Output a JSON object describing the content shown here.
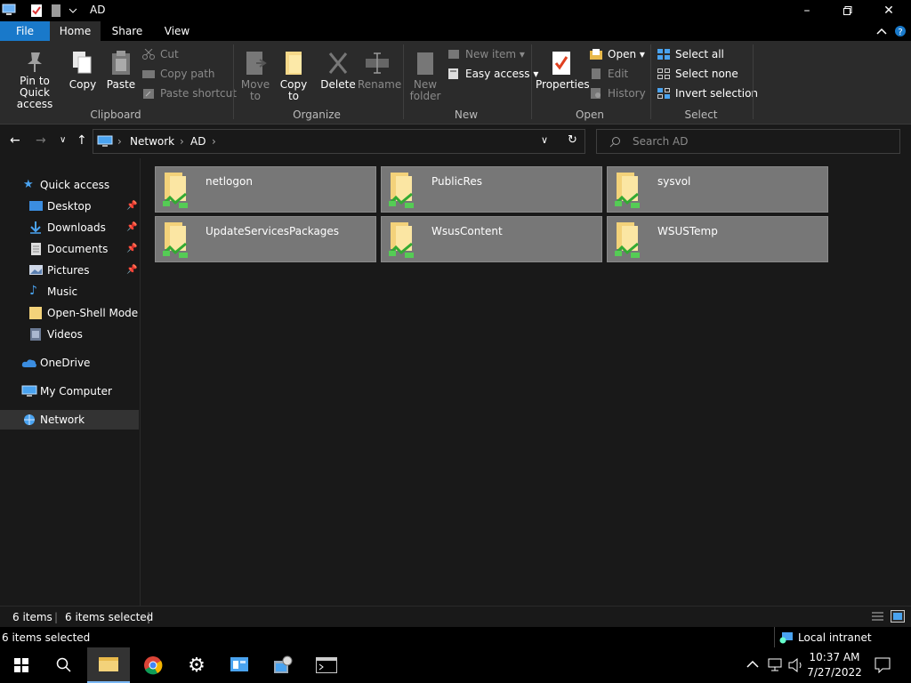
{
  "window": {
    "title": "AD",
    "minimize_icon": "minimize-icon",
    "maximize_icon": "maximize-icon",
    "close_icon": "close-icon"
  },
  "ribbon_tabs": [
    {
      "label": "File"
    },
    {
      "label": "Home"
    },
    {
      "label": "Share"
    },
    {
      "label": "View"
    }
  ],
  "clipboard": {
    "pin_line1": "Pin to Quick",
    "pin_line2": "access",
    "copy": "Copy",
    "paste": "Paste",
    "cut": "Cut",
    "copy_path": "Copy path",
    "paste_shortcut": "Paste shortcut",
    "group": "Clipboard"
  },
  "organize": {
    "move_line1": "Move",
    "move_line2": "to",
    "copy_line1": "Copy",
    "copy_line2": "to",
    "delete": "Delete",
    "rename": "Rename",
    "group": "Organize"
  },
  "new": {
    "new_folder_line1": "New",
    "new_folder_line2": "folder",
    "new_item": "New item",
    "easy_access": "Easy access",
    "group": "New"
  },
  "open": {
    "properties": "Properties",
    "open": "Open",
    "edit": "Edit",
    "history": "History",
    "group": "Open"
  },
  "select": {
    "select_all": "Select all",
    "select_none": "Select none",
    "invert_selection": "Invert selection",
    "group": "Select"
  },
  "address": {
    "crumbs": [
      "Network",
      "AD"
    ],
    "search_placeholder": "Search AD"
  },
  "sidebar": {
    "items": [
      {
        "label": "Quick access",
        "pinned": false
      },
      {
        "label": "Desktop",
        "pinned": true
      },
      {
        "label": "Downloads",
        "pinned": true
      },
      {
        "label": "Documents",
        "pinned": true
      },
      {
        "label": "Pictures",
        "pinned": true
      },
      {
        "label": "Music",
        "pinned": false
      },
      {
        "label": "Open-Shell Modern",
        "pinned": false
      },
      {
        "label": "Videos",
        "pinned": false
      },
      {
        "label": "OneDrive",
        "pinned": false
      },
      {
        "label": "My Computer",
        "pinned": false
      },
      {
        "label": "Network",
        "pinned": false
      }
    ],
    "pin_glyph": "📌"
  },
  "files": [
    {
      "name": "netlogon"
    },
    {
      "name": "PublicRes"
    },
    {
      "name": "sysvol"
    },
    {
      "name": "UpdateServicesPackages"
    },
    {
      "name": "WsusContent"
    },
    {
      "name": "WSUSTemp"
    }
  ],
  "status": {
    "count": "6 items",
    "selected": "6 items selected",
    "bottom_selected": "6 items selected",
    "zone": "Local intranet"
  },
  "taskbar": {
    "time": "10:37 AM",
    "date": "7/27/2022"
  },
  "colors": {
    "accent": "#1979ca",
    "tile_bg": "#777777",
    "ribbon_bg": "#2b2b2b"
  }
}
